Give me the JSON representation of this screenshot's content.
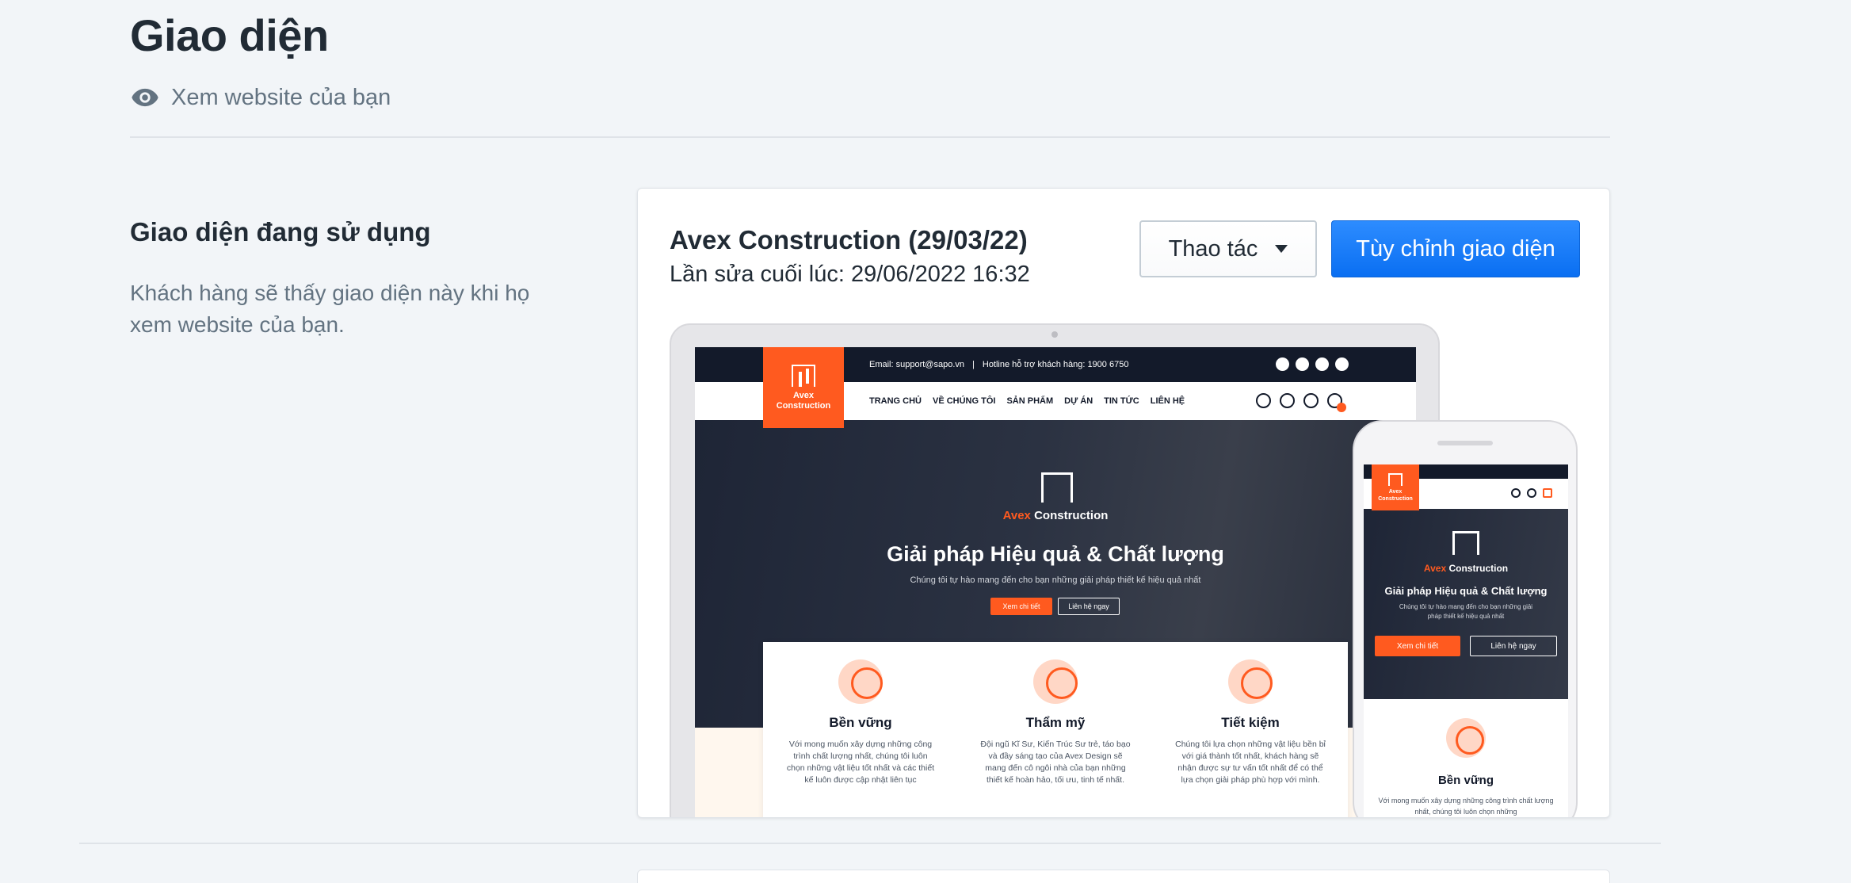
{
  "page": {
    "title": "Giao diện",
    "view_site_label": "Xem website của bạn",
    "view_icon": "eye-icon"
  },
  "section": {
    "title": "Giao diện đang sử dụng",
    "description": "Khách hàng sẽ thấy giao diện này khi họ xem website của bạn."
  },
  "theme": {
    "name": "Avex Construction (29/03/22)",
    "last_edited": "Lần sửa cuối lúc: 29/06/2022 16:32",
    "actions_label": "Thao tác",
    "customize_label": "Tùy chỉnh giao diện"
  },
  "preview": {
    "email": "Email: support@sapo.vn",
    "separator": "|",
    "hotline": "Hotline hỗ trợ khách hàng: 1900 6750",
    "logo_line1": "Avex",
    "logo_line2": "Construction",
    "nav": [
      "TRANG CHỦ",
      "VỀ CHÚNG TÔI",
      "SẢN PHẨM",
      "DỰ ÁN",
      "TIN TỨC",
      "LIÊN HỆ"
    ],
    "brand_accent": "Avex",
    "brand_rest": " Construction",
    "hero_title": "Giải pháp Hiệu quả & Chất lượng",
    "hero_sub": "Chúng tôi tự hào mang đến cho bạn những giải pháp thiết kế hiệu quả nhất",
    "btn_detail": "Xem chi tiết",
    "btn_contact": "Liên hệ ngay",
    "features": [
      {
        "title": "Bền vững",
        "desc": "Với mong muốn xây dựng những công trình chất lượng nhất, chúng tôi luôn chọn những vật liệu tốt nhất và các thiết kế luôn được cập nhật liên tục"
      },
      {
        "title": "Thẩm mỹ",
        "desc": "Đội ngũ Kĩ Sư, Kiến Trúc Sư trẻ, táo bạo và đầy sáng tạo của Avex Design sẽ mang đến cô ngôi nhà của bạn những thiết kế hoàn hảo, tối ưu, tinh tế nhất."
      },
      {
        "title": "Tiết kiệm",
        "desc": "Chúng tôi lựa chọn những vật liệu bền bỉ với giá thành tốt nhất, khách hàng sẽ nhận được sự tư vấn tốt nhất để có thể lựa chọn giải pháp phù hợp với mình."
      }
    ],
    "phone_sub": "Chúng tôi tự hào mang đến cho bạn những giải pháp thiết kế hiệu quả nhất",
    "phone_feature_title": "Bền vững",
    "phone_feature_desc": "Với mong muốn xây dựng những công trình chất lượng nhất, chúng tôi luôn chọn những"
  },
  "colors": {
    "primary": "#0a6ff2",
    "brand_orange": "#ff5a1f",
    "dark_navy": "#131a2a",
    "background": "#f2f5f8"
  }
}
